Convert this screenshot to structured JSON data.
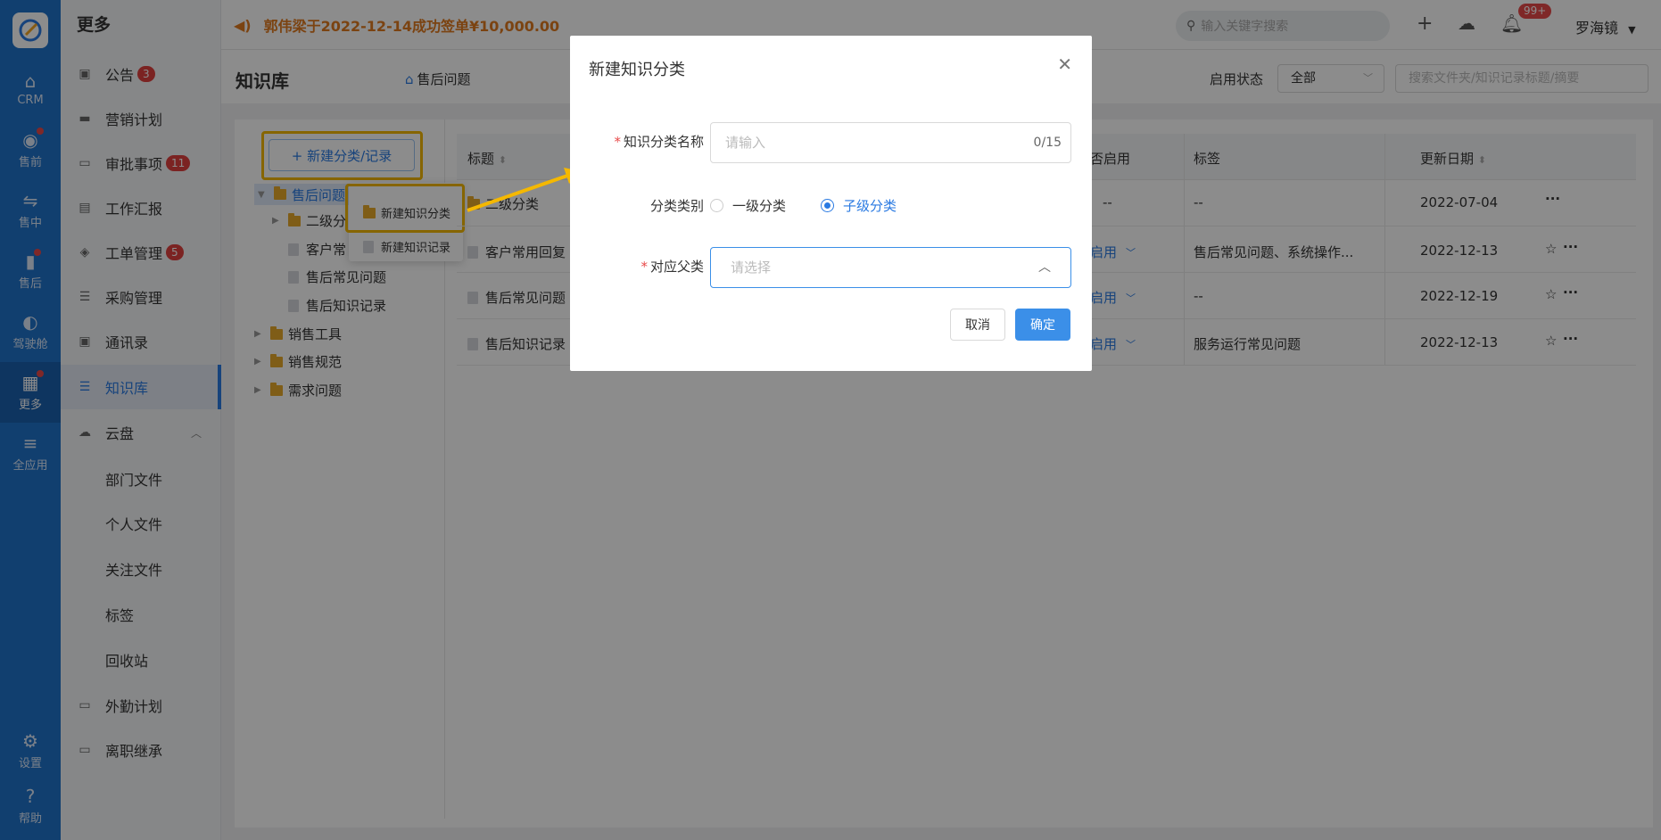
{
  "rail": {
    "items": [
      {
        "label": "CRM",
        "icon": "home-icon"
      },
      {
        "label": "售前",
        "icon": "presale-icon"
      },
      {
        "label": "售中",
        "icon": "handshake-icon"
      },
      {
        "label": "售后",
        "icon": "aftersale-icon"
      },
      {
        "label": "驾驶舱",
        "icon": "dashboard-icon"
      },
      {
        "label": "更多",
        "icon": "grid-icon"
      },
      {
        "label": "全应用",
        "icon": "menu-icon"
      },
      {
        "label": "设置",
        "icon": "gear-icon"
      },
      {
        "label": "帮助",
        "icon": "help-icon"
      }
    ]
  },
  "sidebar": {
    "header": "更多",
    "items": [
      {
        "label": "公告",
        "badge": "3"
      },
      {
        "label": "营销计划"
      },
      {
        "label": "审批事项",
        "badge": "11"
      },
      {
        "label": "工作汇报"
      },
      {
        "label": "工单管理",
        "badge": "5"
      },
      {
        "label": "采购管理"
      },
      {
        "label": "通讯录"
      },
      {
        "label": "知识库"
      },
      {
        "label": "云盘"
      },
      {
        "label": "部门文件"
      },
      {
        "label": "个人文件"
      },
      {
        "label": "关注文件"
      },
      {
        "label": "标签"
      },
      {
        "label": "回收站"
      },
      {
        "label": "外勤计划"
      },
      {
        "label": "离职继承"
      }
    ]
  },
  "topbar": {
    "notice": "郭伟梁于2022-12-14成功签单¥10,000.00",
    "search_placeholder": "输入关键字搜索",
    "notif_badge": "99+",
    "user": "罗海镜"
  },
  "page": {
    "title": "知识库",
    "crumb": "售后问题",
    "status_label": "启用状态",
    "status_value": "全部",
    "keyword_placeholder": "搜索文件夹/知识记录标题/摘要"
  },
  "tree": {
    "new_button": "+ 新建分类/记录",
    "nodes": [
      "售后问题",
      "二级分",
      "客户常",
      "售后常见问题",
      "售后知识记录",
      "销售工具",
      "销售规范",
      "需求问题"
    ],
    "context_menu": [
      "新建知识分类",
      "新建知识记录"
    ]
  },
  "table": {
    "headers": [
      "标题",
      "否启用",
      "标签",
      "更新日期"
    ],
    "rows": [
      {
        "title": "二级分类",
        "status": "--",
        "tags": "--",
        "date": "2022-07-04"
      },
      {
        "title": "客户常用回复",
        "status": "启用",
        "tags": "售后常见问题、系统操作...",
        "date": "2022-12-13"
      },
      {
        "title": "售后常见问题",
        "status": "启用",
        "tags": "--",
        "date": "2022-12-19"
      },
      {
        "title": "售后知识记录",
        "status": "启用",
        "tags": "服务运行常见问题",
        "date": "2022-12-13"
      }
    ]
  },
  "modal": {
    "title": "新建知识分类",
    "name_label": "知识分类名称",
    "name_placeholder": "请输入",
    "name_count": "0/15",
    "type_label": "分类类别",
    "type_options": [
      "一级分类",
      "子级分类"
    ],
    "type_selected": "子级分类",
    "parent_label": "对应父类",
    "parent_placeholder": "请选择",
    "cancel": "取消",
    "confirm": "确定"
  },
  "colors": {
    "brand": "#1f73cb",
    "accent": "#3b8fe8",
    "highlight": "#f5b800",
    "notice": "#e07a1f"
  }
}
